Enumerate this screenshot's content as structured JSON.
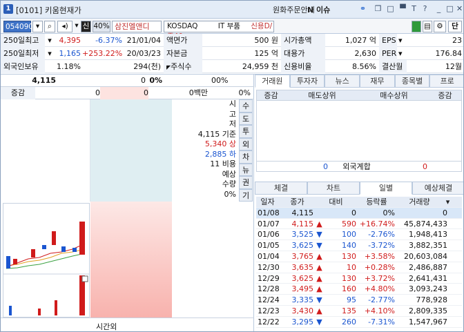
{
  "window": {
    "logo": "1",
    "title": "[0101] 키움현재가",
    "menu1": "원화주문안내",
    "menu2": "N 이슈"
  },
  "icons": {
    "link": "link-icon",
    "restore": "restore-icon",
    "maximize": "maximize-icon",
    "pin": "pin-icon",
    "help": "help-icon",
    "minimize": "minimize-icon",
    "close": "close-icon"
  },
  "toolbar": {
    "code": "054090",
    "search_icon": "search-icon",
    "sound_icon": "sound-icon",
    "credit_tag": "신",
    "margin": "40%",
    "name": "삼진엘앤디",
    "market": "KOSDAQ",
    "sector": "IT 부품",
    "credit": "신용D/증40",
    "gear": "gear-icon",
    "unit": "단"
  },
  "info": {
    "rows": [
      {
        "a_label": "250일최고",
        "a_val": "4,395",
        "a_pct": "-6.37%",
        "a_date": "21/01/04",
        "b_label": "액면가",
        "b_val": "500 원",
        "c_label": "시가총액",
        "c_val": "1,027 억",
        "d_label": "EPS",
        "d_val": "23"
      },
      {
        "a_label": "250일최저",
        "a_val": "1,165",
        "a_pct": "+253.22%",
        "a_date": "20/03/23",
        "b_label": "자본금",
        "b_val": "125 억",
        "c_label": "대용가",
        "c_val": "2,630",
        "d_label": "PER",
        "d_val": "176.84"
      },
      {
        "a_label": "외국인보유",
        "a_val": "1.18%",
        "a_pct": "",
        "a_date": "294(천)",
        "b_label": "주식수",
        "b_val": "24,959 천",
        "c_label": "신용비율",
        "c_val": "8.56%",
        "d_label": "결산월",
        "d_val": "12월"
      }
    ]
  },
  "quote": {
    "price": "4,115",
    "v1": "0",
    "v2": "0%",
    "v3": "0",
    "v4": "0%",
    "delta_label": "증감",
    "d1": "0",
    "d2": "0",
    "d3": "0백만",
    "d4": "0%"
  },
  "stats": {
    "open": "시",
    "high": "고",
    "low": "저",
    "base": "4,115 기준",
    "upper": "5,340 상",
    "lower": "2,885 하",
    "ratio": "11 비용",
    "expect": "예상",
    "qty": "수량",
    "pct": "0%"
  },
  "vtabs": [
    "수",
    "도",
    "투",
    "외",
    "차",
    "뉴",
    "권",
    "기"
  ],
  "bottom": {
    "after": "시간외"
  },
  "right": {
    "tabs1": [
      "거래원",
      "투자자",
      "뉴스",
      "재무",
      "종목별",
      "프로"
    ],
    "trade_head": [
      "증감",
      "매도상위",
      "매수상위",
      "증감"
    ],
    "foreign": {
      "l": "0",
      "label": "외국계합",
      "r": "0"
    },
    "tabs2": [
      "체결",
      "차트",
      "일별",
      "예상체결"
    ],
    "daily_head": [
      "일자",
      "종가",
      "대비",
      "등락률",
      "거래량"
    ],
    "daily": [
      {
        "d": "01/08",
        "c": "4,115",
        "s": "",
        "ch": "0",
        "r": "0%",
        "v": "0",
        "dir": "flat"
      },
      {
        "d": "01/07",
        "c": "4,115",
        "s": "▲",
        "ch": "590",
        "r": "+16.74%",
        "v": "45,874,433",
        "dir": "up"
      },
      {
        "d": "01/06",
        "c": "3,525",
        "s": "▼",
        "ch": "100",
        "r": "-2.76%",
        "v": "1,948,413",
        "dir": "down"
      },
      {
        "d": "01/05",
        "c": "3,625",
        "s": "▼",
        "ch": "140",
        "r": "-3.72%",
        "v": "3,882,351",
        "dir": "down"
      },
      {
        "d": "01/04",
        "c": "3,765",
        "s": "▲",
        "ch": "130",
        "r": "+3.58%",
        "v": "20,603,084",
        "dir": "up"
      },
      {
        "d": "12/30",
        "c": "3,635",
        "s": "▲",
        "ch": "10",
        "r": "+0.28%",
        "v": "2,486,887",
        "dir": "up"
      },
      {
        "d": "12/29",
        "c": "3,625",
        "s": "▲",
        "ch": "130",
        "r": "+3.72%",
        "v": "2,641,431",
        "dir": "up"
      },
      {
        "d": "12/28",
        "c": "3,495",
        "s": "▲",
        "ch": "160",
        "r": "+4.80%",
        "v": "3,093,243",
        "dir": "up"
      },
      {
        "d": "12/24",
        "c": "3,335",
        "s": "▼",
        "ch": "95",
        "r": "-2.77%",
        "v": "778,928",
        "dir": "down"
      },
      {
        "d": "12/23",
        "c": "3,430",
        "s": "▲",
        "ch": "135",
        "r": "+4.10%",
        "v": "2,809,335",
        "dir": "up"
      },
      {
        "d": "12/22",
        "c": "3,295",
        "s": "▼",
        "ch": "260",
        "r": "-7.31%",
        "v": "1,547,967",
        "dir": "down"
      }
    ]
  },
  "colors": {
    "up": "#d01b1b",
    "down": "#1a55d0",
    "accent": "#3f73c7"
  }
}
